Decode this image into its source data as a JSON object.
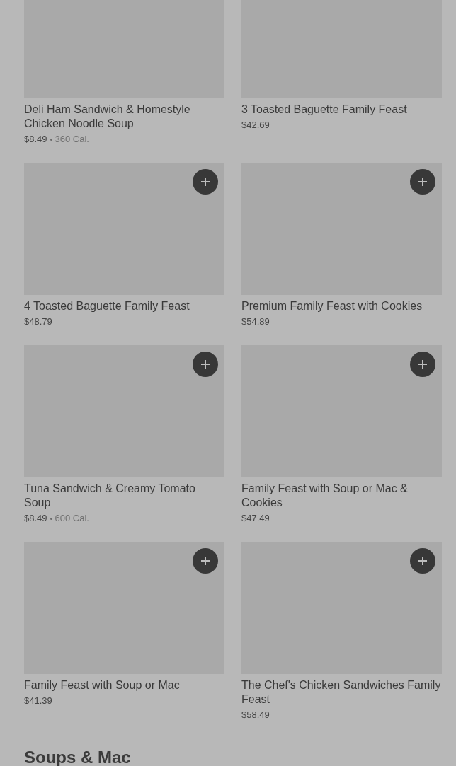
{
  "items": [
    {
      "name": "Deli Ham Sandwich & Homestyle Chicken Noodle Soup",
      "price": "$8.49",
      "calories": "360 Cal."
    },
    {
      "name": "3 Toasted Baguette Family Feast",
      "price": "$42.69"
    },
    {
      "name": "4 Toasted Baguette Family Feast",
      "price": "$48.79"
    },
    {
      "name": "Premium Family Feast with Cookies",
      "price": "$54.89"
    },
    {
      "name": "Tuna Sandwich & Creamy Tomato Soup",
      "price": "$8.49",
      "calories": "600 Cal."
    },
    {
      "name": "Family Feast with Soup or Mac & Cookies",
      "price": "$47.49"
    },
    {
      "name": "Family Feast with Soup or Mac",
      "price": "$41.39"
    },
    {
      "name": "The Chef's Chicken Sandwiches Family Feast",
      "price": "$58.49"
    }
  ],
  "next_section": {
    "title": "Soups & Mac"
  }
}
